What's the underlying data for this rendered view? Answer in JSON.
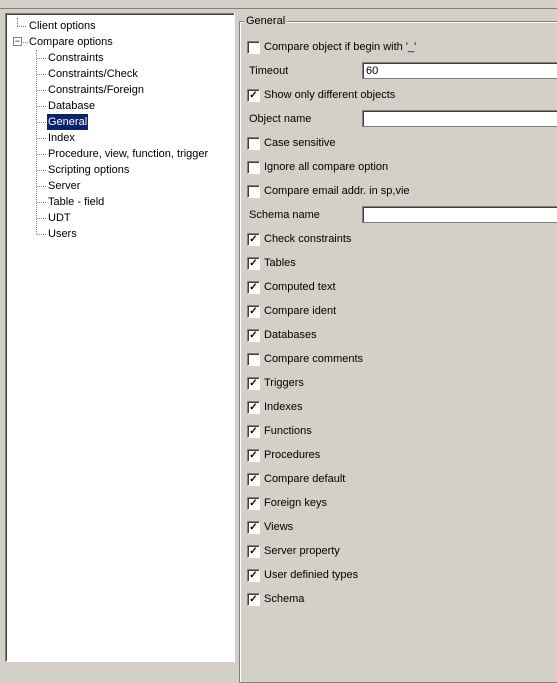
{
  "tree": {
    "root": [
      {
        "label": "Client options"
      },
      {
        "label": "Compare options",
        "expanded": true
      }
    ],
    "children": [
      {
        "label": "Constraints"
      },
      {
        "label": "Constraints/Check"
      },
      {
        "label": "Constraints/Foreign"
      },
      {
        "label": "Database"
      },
      {
        "label": "General",
        "selected": true
      },
      {
        "label": "Index"
      },
      {
        "label": "Procedure, view, function, trigger"
      },
      {
        "label": "Scripting options"
      },
      {
        "label": "Server"
      },
      {
        "label": "Table - field"
      },
      {
        "label": "UDT"
      },
      {
        "label": "Users"
      }
    ]
  },
  "group": {
    "title": "General"
  },
  "fields": {
    "timeout_label": "Timeout",
    "timeout_value": "60",
    "object_name_label": "Object name",
    "object_name_value": "",
    "schema_name_label": "Schema name",
    "schema_name_value": ""
  },
  "top_checks": [
    {
      "label": "Compare object if begin with '_'",
      "checked": false
    },
    {
      "label": "Show only different objects",
      "checked": true
    },
    {
      "label": "Case sensitive",
      "checked": false
    },
    {
      "label": "Ignore all compare option",
      "checked": false
    },
    {
      "label": "Compare  email  addr.  in sp,vie",
      "checked": false
    }
  ],
  "checks": [
    {
      "label": "Check constraints",
      "checked": true
    },
    {
      "label": "Tables",
      "checked": true
    },
    {
      "label": "Computed text",
      "checked": true
    },
    {
      "label": "Compare ident",
      "checked": true
    },
    {
      "label": "Databases",
      "checked": true
    },
    {
      "label": "Compare comments",
      "checked": false
    },
    {
      "label": "Triggers",
      "checked": true
    },
    {
      "label": "Indexes",
      "checked": true
    },
    {
      "label": "Functions",
      "checked": true
    },
    {
      "label": "Procedures",
      "checked": true
    },
    {
      "label": "Compare default",
      "checked": true
    },
    {
      "label": "Foreign keys",
      "checked": true
    },
    {
      "label": "Views",
      "checked": true
    },
    {
      "label": "Server property",
      "checked": true
    },
    {
      "label": "User definied types",
      "checked": true
    },
    {
      "label": "Schema",
      "checked": true
    }
  ]
}
